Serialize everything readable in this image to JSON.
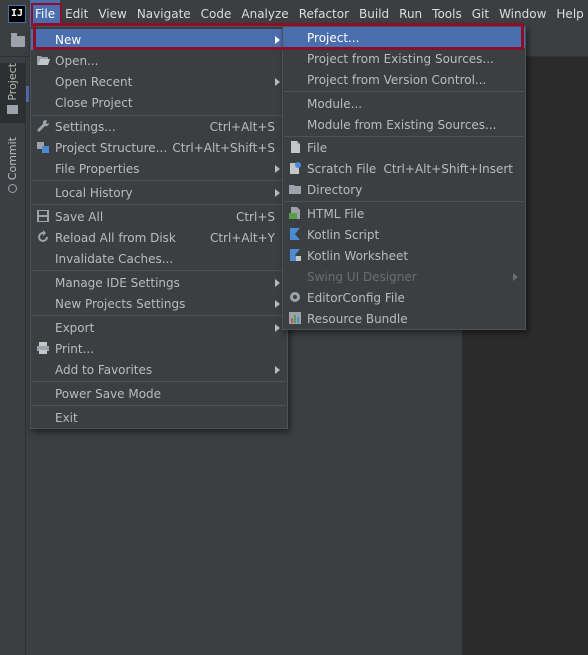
{
  "app": {
    "logo_text": "IJ",
    "menubar": [
      "File",
      "Edit",
      "View",
      "Navigate",
      "Code",
      "Analyze",
      "Refactor",
      "Build",
      "Run",
      "Tools",
      "Git",
      "Window",
      "Help"
    ]
  },
  "left_strip": {
    "project_label": "Project",
    "commit_label": "Commit"
  },
  "file_menu": {
    "new": "New",
    "open": "Open...",
    "open_recent": "Open Recent",
    "close_project": "Close Project",
    "settings": "Settings...",
    "settings_sc": "Ctrl+Alt+S",
    "project_structure": "Project Structure...",
    "project_structure_sc": "Ctrl+Alt+Shift+S",
    "file_properties": "File Properties",
    "local_history": "Local History",
    "save_all": "Save All",
    "save_all_sc": "Ctrl+S",
    "reload": "Reload All from Disk",
    "reload_sc": "Ctrl+Alt+Y",
    "invalidate": "Invalidate Caches...",
    "manage_ide": "Manage IDE Settings",
    "new_projects_settings": "New Projects Settings",
    "export": "Export",
    "print": "Print...",
    "add_favorites": "Add to Favorites",
    "power_save": "Power Save Mode",
    "exit": "Exit"
  },
  "new_menu": {
    "project": "Project...",
    "project_existing": "Project from Existing Sources...",
    "project_vcs": "Project from Version Control...",
    "module": "Module...",
    "module_existing": "Module from Existing Sources...",
    "file": "File",
    "scratch": "Scratch File",
    "scratch_sc": "Ctrl+Alt+Shift+Insert",
    "directory": "Directory",
    "html": "HTML File",
    "kotlin_script": "Kotlin Script",
    "kotlin_worksheet": "Kotlin Worksheet",
    "swing": "Swing UI Designer",
    "editorconfig": "EditorConfig File",
    "resource_bundle": "Resource Bundle"
  },
  "colors": {
    "highlight": "#4b6eaf",
    "annotation": "#8b0f2b",
    "background": "#3c3f41"
  }
}
